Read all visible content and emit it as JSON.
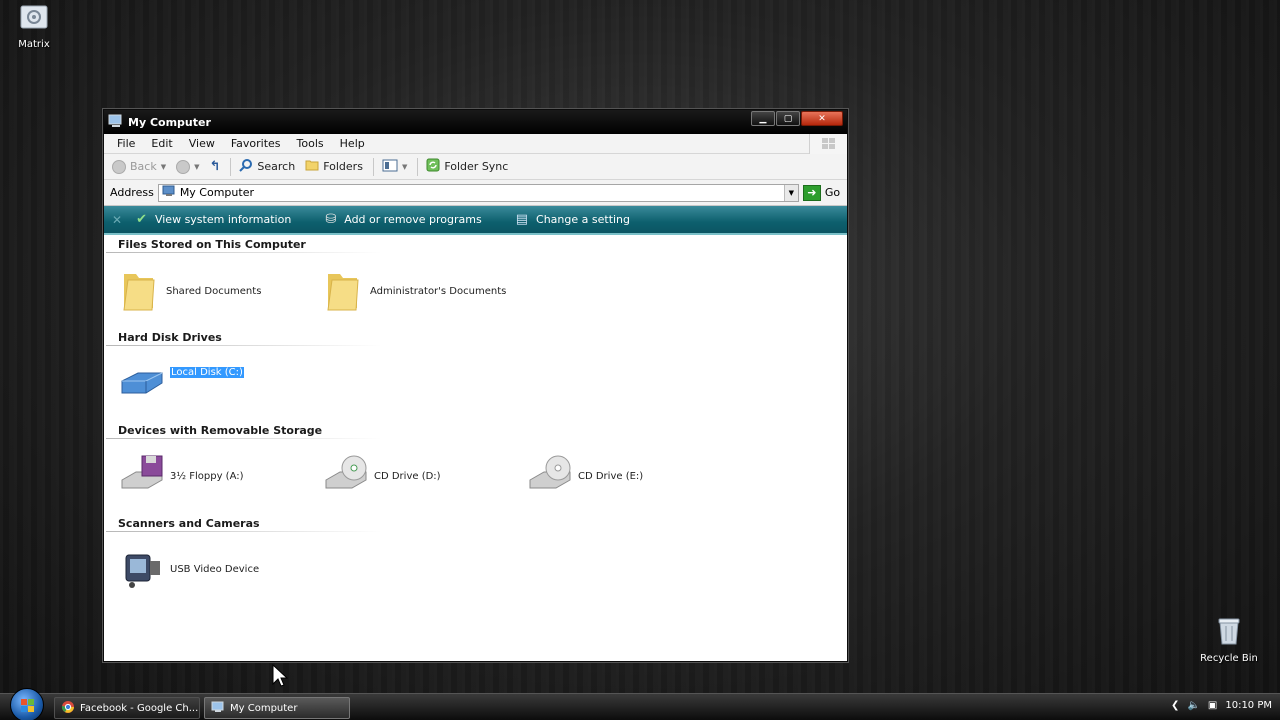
{
  "desktop": {
    "icons": [
      {
        "label": "Matrix"
      },
      {
        "label": "Recycle Bin"
      }
    ]
  },
  "window": {
    "title": "My Computer",
    "menu": [
      "File",
      "Edit",
      "View",
      "Favorites",
      "Tools",
      "Help"
    ],
    "toolbar": {
      "back_label": "Back",
      "search_label": "Search",
      "folders_label": "Folders",
      "folder_sync_label": "Folder Sync"
    },
    "address": {
      "label": "Address",
      "value": "My Computer",
      "go_label": "Go"
    },
    "tasks": [
      {
        "label": "View system information",
        "icon": "checkmark-icon"
      },
      {
        "label": "Add or remove programs",
        "icon": "programs-icon"
      },
      {
        "label": "Change a setting",
        "icon": "settings-icon"
      }
    ],
    "groups": {
      "files": {
        "heading": "Files Stored on This Computer",
        "items": [
          "Shared Documents",
          "Administrator's Documents"
        ]
      },
      "hdd": {
        "heading": "Hard Disk Drives",
        "items": [
          "Local Disk (C:)"
        ]
      },
      "removable": {
        "heading": "Devices with Removable Storage",
        "items": [
          "3½ Floppy (A:)",
          "CD Drive (D:)",
          "CD Drive (E:)"
        ]
      },
      "scanners": {
        "heading": "Scanners and Cameras",
        "items": [
          "USB Video Device"
        ]
      }
    }
  },
  "taskbar": {
    "buttons": [
      "Facebook - Google Ch...",
      "My Computer"
    ],
    "clock": "10:10 PM"
  },
  "colors": {
    "task_pane": "#0d5f6d",
    "selection": "#3399ff"
  }
}
